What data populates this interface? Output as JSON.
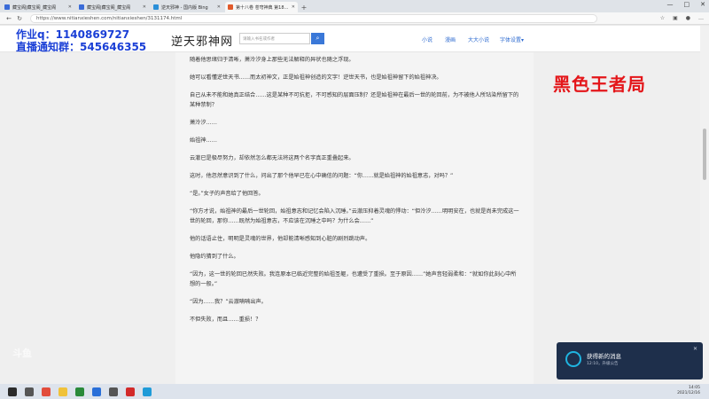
{
  "browser": {
    "tabs": [
      {
        "label": "藏宝阁|藏宝阁_藏宝阁",
        "color": "#3a6bd8",
        "active": false
      },
      {
        "label": "藏宝阁|藏宝阁_藏宝阁",
        "color": "#3a6bd8",
        "active": false
      },
      {
        "label": "逆天邪神 - 国内版 Bing",
        "color": "#2a8fd8",
        "active": false
      },
      {
        "label": "第十八卷 苍穹神典 第1828章 轮",
        "color": "#e15a2b",
        "active": true
      }
    ],
    "url": "https://www.nitianxieshen.com/nitianxieshen/3131174.html",
    "window_controls": [
      "—",
      "□",
      "✕"
    ]
  },
  "header": {
    "logo": "逆天邪神网",
    "search_placeholder": "请输入书名或作者",
    "nav": [
      "小说",
      "漫画",
      "大大小说",
      "字体设置▾"
    ]
  },
  "article": {
    "paragraphs": [
      "随着他思绪归于清晰，萧泠汐身上那些无法解释的异状也随之浮现。",
      "她可以看懂逆世天书……而太初神文，正是始祖神创造的文字！逆世天书，也是始祖神留下的始祖神决。",
      "自己从未不能和她真正结合……这是某种不可抗拒，不可感知的层面压制？还是始祖神在最后一世的轮回前，为不被他人所玷染所留下的某种禁制？",
      "萧泠汐……",
      "始祖神……",
      "云澈已是极尽努力，却依然怎么都无法将这两个名字真正重叠起来。",
      "这时，他忽然意识到了什么，问出了那个他早已在心中确信的问题：“你……就是始祖神的始祖意志，对吗？”",
      "“是。”女子的声音给了他回答。",
      "“你方才说，始祖神的最后一世轮回，始祖意志和记忆会陷入沉睡。”云澈压抑着灵魂的悸动：“但泠汐……明明安在，也就是尚未完成这一世的轮回，那你……既然为始祖意志，不应该在沉睡之中吗？为什么会……”",
      "他的话语止住，明明是灵魂的世界，他却能清晰感知到心脏的剧烈跳动声。",
      "他隐约猜到了什么。",
      "“因为，这一世的轮回已然失败。我连原本已临近完整的始祖圣躯，也遭受了重损。至于原因……”她声音轻弱柔和：“就如你此刻心中所想的一般。”",
      "“因为……我？”云澈喃喃出声。",
      "不但失败，而且……重损！？"
    ]
  },
  "overlay": {
    "qq": "作业q：1140869727",
    "group": "直播通知群：545646355",
    "room": "黑色王者局",
    "watermark": "斗鱼"
  },
  "notification": {
    "title": "获得新的消息",
    "subtitle": "12:10，升级公告",
    "close": "✕"
  },
  "taskbar": {
    "time": "14:05",
    "date": "2021/12/16",
    "icons": [
      {
        "name": "start-icon",
        "color": "#2b2b2b"
      },
      {
        "name": "search-icon",
        "color": "#555555"
      },
      {
        "name": "chrome-icon",
        "color": "#e24c3b"
      },
      {
        "name": "folder-icon",
        "color": "#f0c23a"
      },
      {
        "name": "game-icon",
        "color": "#2a8a3a"
      },
      {
        "name": "blue-app-icon",
        "color": "#2a6fd8"
      },
      {
        "name": "camera-icon",
        "color": "#555555"
      },
      {
        "name": "red-app-icon",
        "color": "#d22a2a"
      },
      {
        "name": "edge-icon",
        "color": "#1f9bd8"
      }
    ]
  }
}
